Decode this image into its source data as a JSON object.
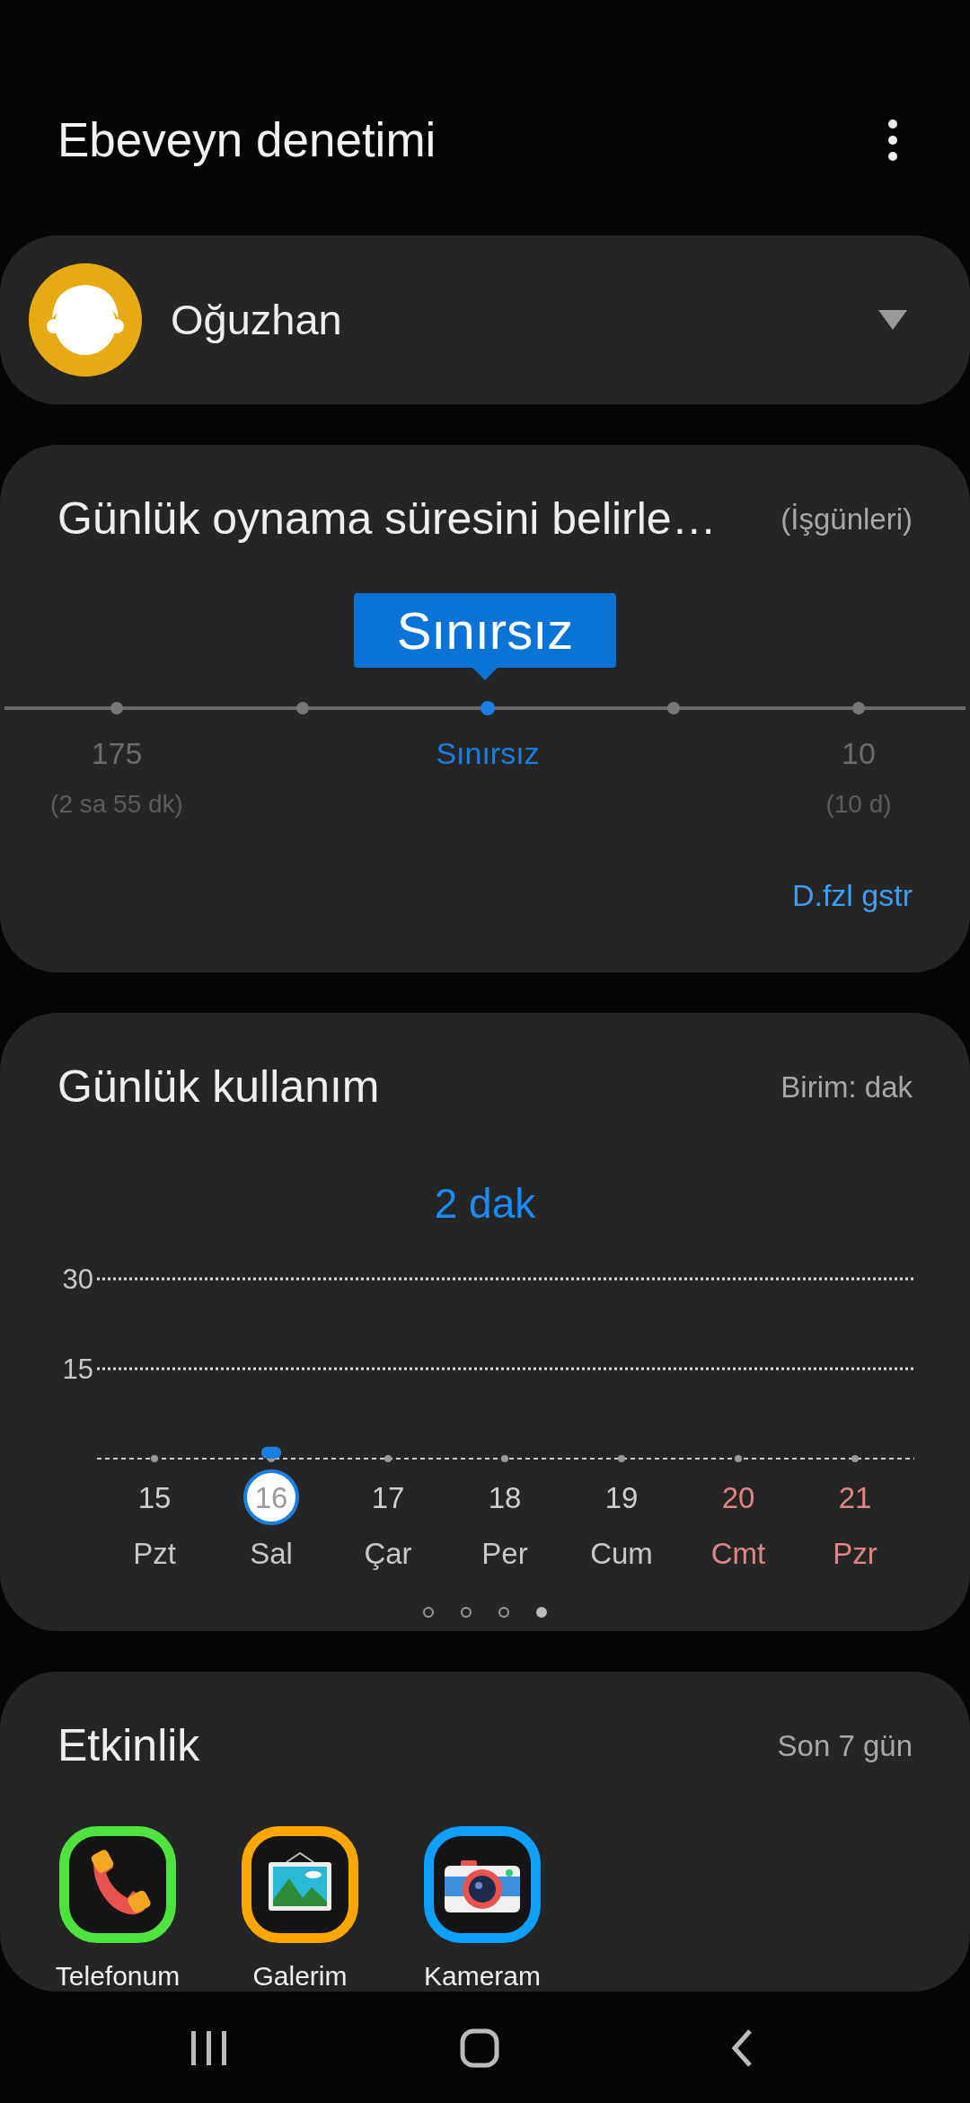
{
  "header": {
    "title": "Ebeveyn denetimi"
  },
  "profile": {
    "name": "Oğuzhan"
  },
  "playtime": {
    "title": "Günlük oynama süresini belirle…",
    "days": "(İşgünleri)",
    "tooltip": "Sınırsız",
    "level": 0.5,
    "ticks": [
      {
        "value": "175",
        "detail": "(2 sa 55 dk)"
      },
      {
        "value": "Sınırsız"
      },
      {
        "value": "10",
        "detail": "(10 d)"
      }
    ],
    "more": "D.fzl gstr"
  },
  "usage": {
    "title": "Günlük kullanım",
    "unit": "Birim: dak",
    "total": "2 dak",
    "chart_data": {
      "type": "bar",
      "categories": [
        "15",
        "16",
        "17",
        "18",
        "19",
        "20",
        "21"
      ],
      "values": [
        null,
        2,
        null,
        null,
        null,
        null,
        null
      ],
      "ylim": [
        0,
        30
      ],
      "yticks": [
        15,
        30
      ]
    },
    "days": [
      {
        "weekday": "Pzt",
        "selected": false,
        "weekend": false
      },
      {
        "weekday": "Sal",
        "selected": true,
        "weekend": false
      },
      {
        "weekday": "Çar",
        "selected": false,
        "weekend": false
      },
      {
        "weekday": "Per",
        "selected": false,
        "weekend": false
      },
      {
        "weekday": "Cum",
        "selected": false,
        "weekend": false
      },
      {
        "weekday": "Cmt",
        "selected": false,
        "weekend": true
      },
      {
        "weekday": "Pzr",
        "selected": false,
        "weekend": true
      }
    ],
    "pages": [
      {
        "selected": false
      },
      {
        "selected": false
      },
      {
        "selected": false
      },
      {
        "selected": true
      }
    ]
  },
  "activity": {
    "title": "Etkinlik",
    "period": "Son 7 gün",
    "apps": [
      {
        "name": "Telefonum",
        "kind": "phone",
        "color": "#4ee33e"
      },
      {
        "name": "Galerim",
        "kind": "gallery",
        "color": "#ffa700"
      },
      {
        "name": "Kameram",
        "kind": "camera",
        "color": "#0fa0ff"
      }
    ]
  }
}
